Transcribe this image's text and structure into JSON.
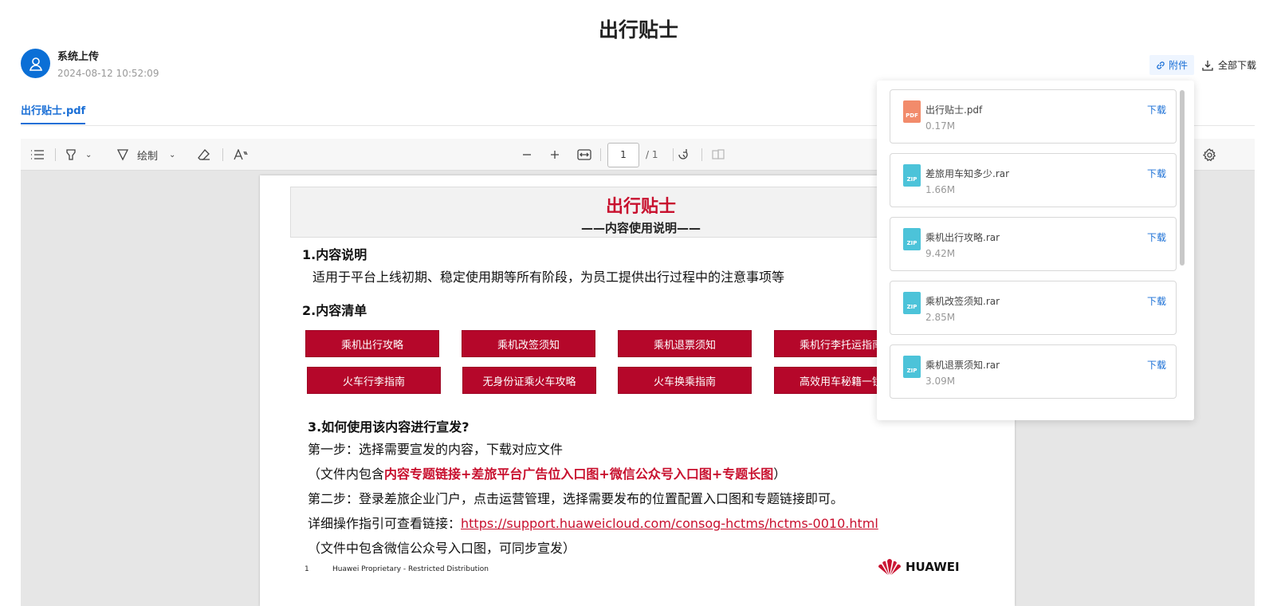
{
  "header": {
    "title": "出行贴士",
    "author_name": "系统上传",
    "author_time": "2024-08-12 10:52:09",
    "attach_label": "附件",
    "download_all_label": "全部下载"
  },
  "tabs": [
    {
      "label": "出行贴士.pdf"
    }
  ],
  "toolbar": {
    "draw_label": "绘制",
    "page_current": "1",
    "page_total": "/ 1"
  },
  "document": {
    "title": "出行贴士",
    "subtitle": "——内容使用说明——",
    "section1": "1.内容说明",
    "section1_text": "适用于平台上线初期、稳定使用期等所有阶段，为员工提供出行过程中的注意事项等",
    "section2": "2.内容清单",
    "buttons_row1": [
      "乘机出行攻略",
      "乘机改签须知",
      "乘机退票须知",
      "乘机行李托运指南"
    ],
    "buttons_row2": [
      "火车行李指南",
      "无身份证乘火车攻略",
      "火车换乘指南",
      "高效用车秘籍一镜"
    ],
    "section3": "3.如何使用该内容进行宣发?",
    "step1": "第一步：选择需要宣发的内容，下载对应文件",
    "step1_note_pre": "（文件内包含",
    "step1_note_red": "内容专题链接+差旅平台广告位入口图+微信公众号入口图+专题长图",
    "step1_note_post": "）",
    "step2": "第二步：登录差旅企业门户，点击运营管理，选择需要发布的位置配置入口图和专题链接即可。",
    "guide_pre": "详细操作指引可查看链接：",
    "guide_link": "https://support.huaweicloud.com/consog-hctms/hctms-0010.html",
    "guide_note": "（文件中包含微信公众号入口图，可同步宣发）",
    "footer_page": "1",
    "footer_text": "Huawei Proprietary - Restricted Distribution",
    "brand": "HUAWEI"
  },
  "attachments": {
    "download_label": "下载",
    "files": [
      {
        "name": "出行贴士.pdf",
        "size": "0.17M",
        "type": "PDF"
      },
      {
        "name": "差旅用车知多少.rar",
        "size": "1.66M",
        "type": "ZIP"
      },
      {
        "name": "乘机出行攻略.rar",
        "size": "9.42M",
        "type": "ZIP"
      },
      {
        "name": "乘机改签须知.rar",
        "size": "2.85M",
        "type": "ZIP"
      },
      {
        "name": "乘机退票须知.rar",
        "size": "3.09M",
        "type": "ZIP"
      }
    ]
  },
  "colors": {
    "accent": "#1a6fd6",
    "brand_red": "#c8102e",
    "button_red": "#b5072a",
    "pdf_icon": "#f28b6b",
    "zip_icon": "#4cc3d9"
  }
}
